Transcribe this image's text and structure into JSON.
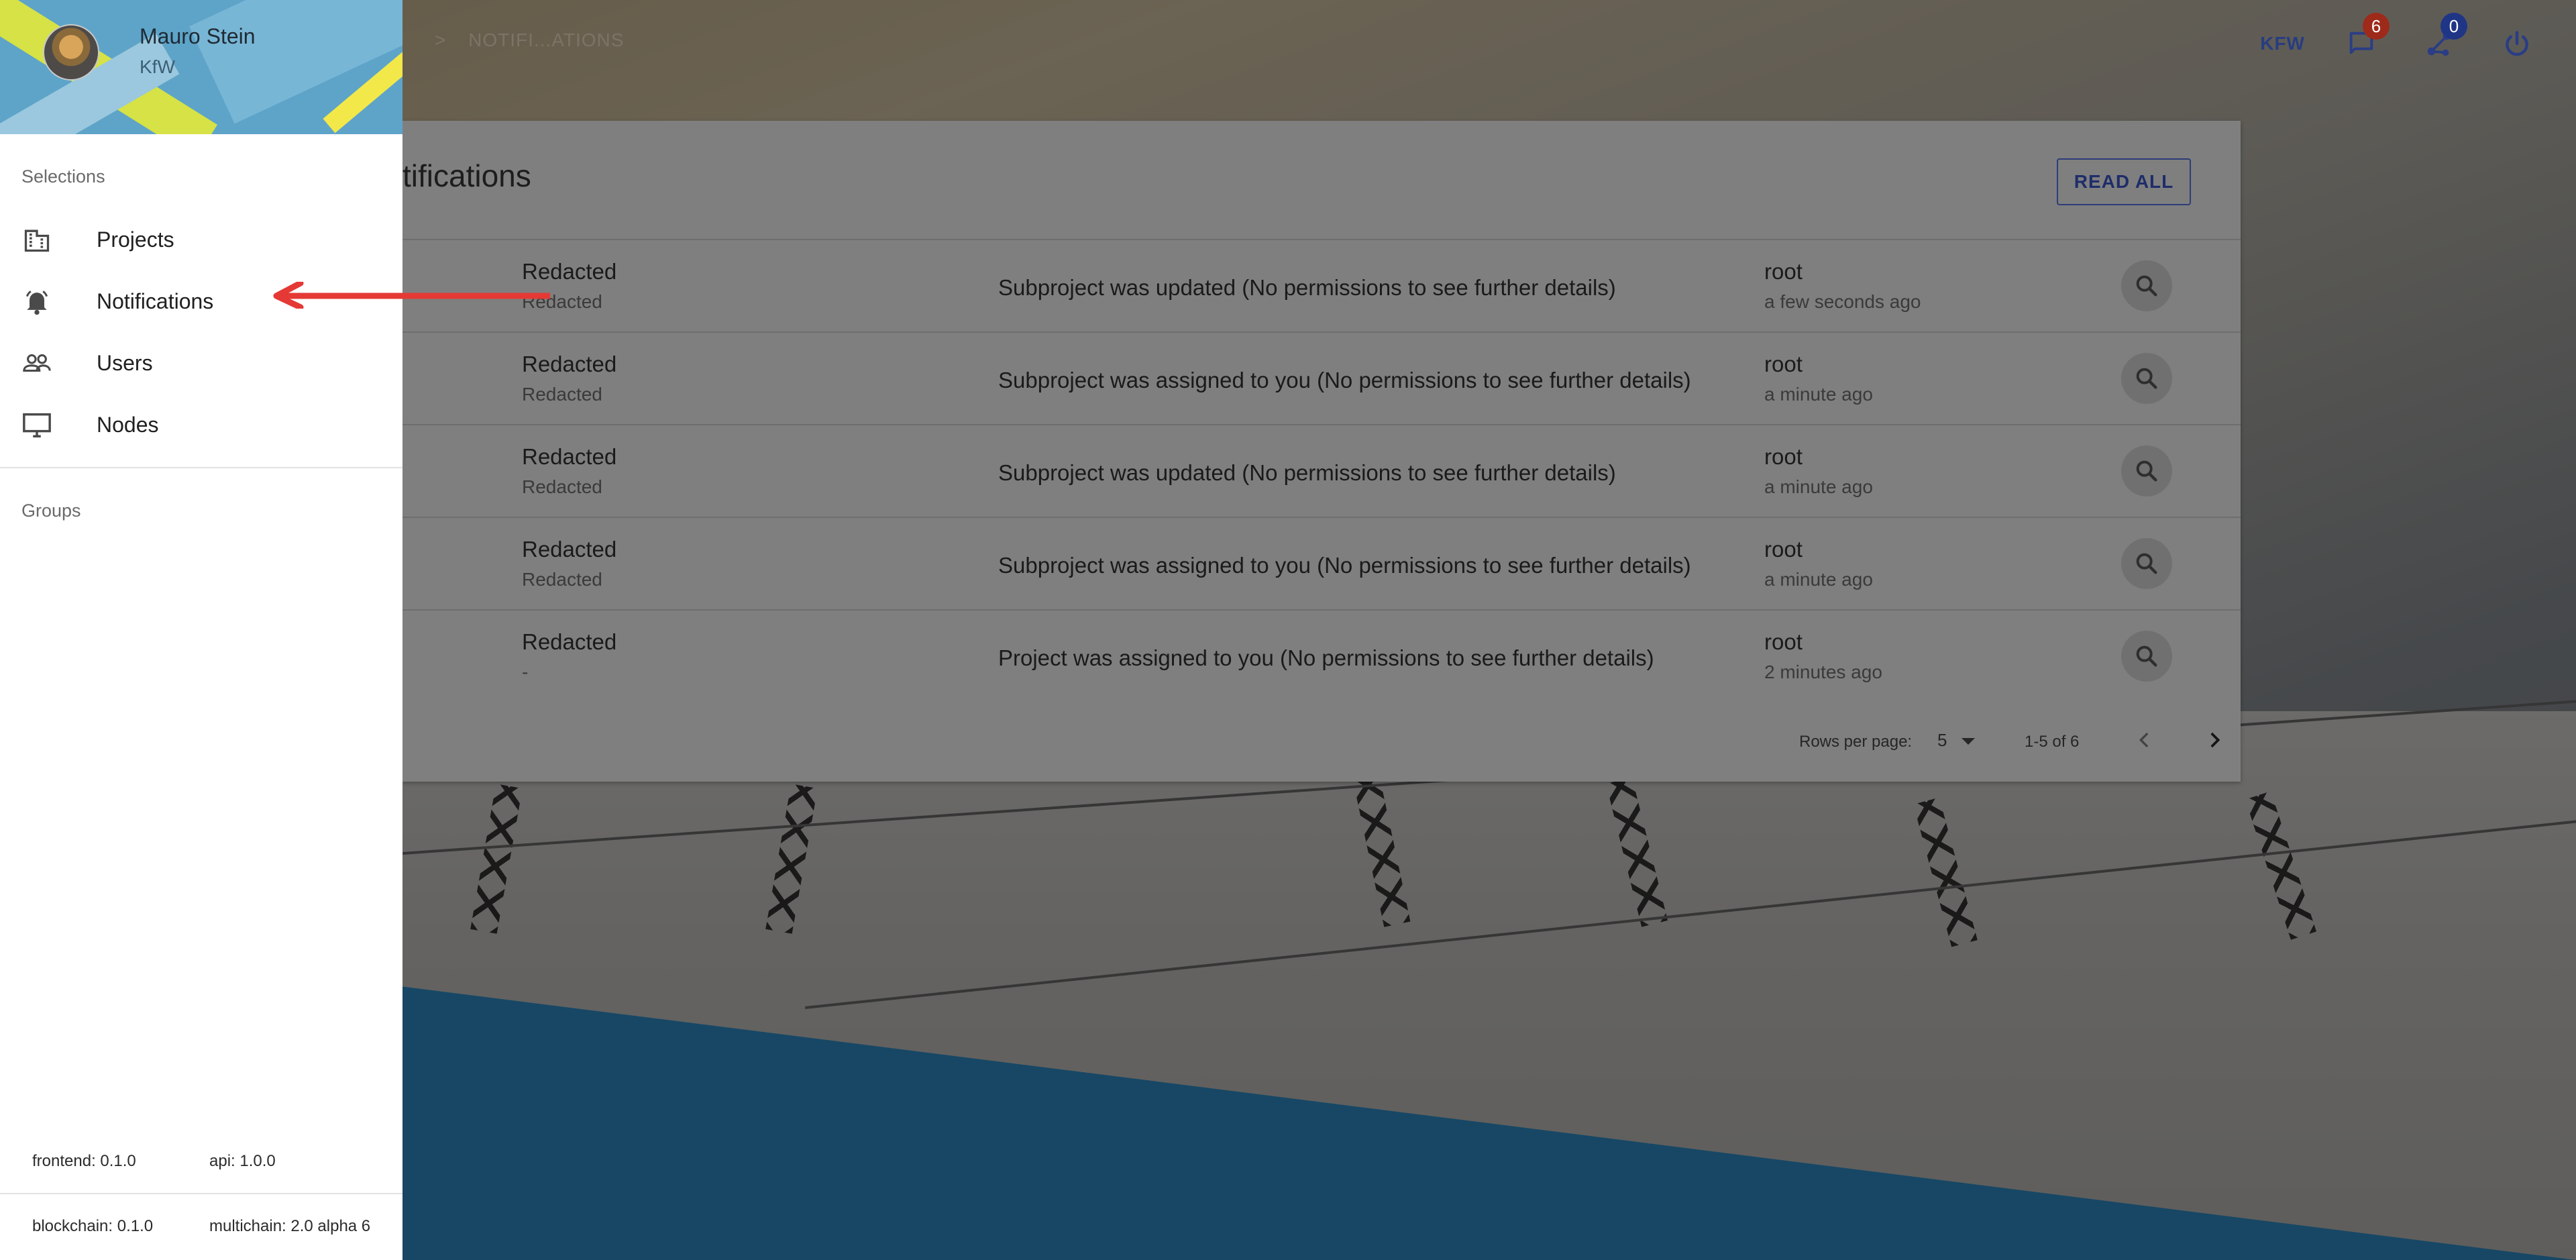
{
  "drawer": {
    "user_name": "Mauro Stein",
    "user_org": "KfW",
    "selections_label": "Selections",
    "items": [
      {
        "label": "Projects",
        "icon": "building-icon"
      },
      {
        "label": "Notifications",
        "icon": "bell-icon"
      },
      {
        "label": "Users",
        "icon": "users-icon"
      },
      {
        "label": "Nodes",
        "icon": "desktop-icon"
      }
    ],
    "groups_label": "Groups",
    "versions": {
      "frontend": "frontend: 0.1.0",
      "api": "api: 1.0.0",
      "blockchain": "blockchain: 0.1.0",
      "multichain": "multichain: 2.0 alpha 6"
    }
  },
  "topbar": {
    "breadcrumb_sep": ">",
    "breadcrumb": "NOTIFI...ATIONS",
    "org": "KFW",
    "notifications_count": "6",
    "peers_count": "0"
  },
  "card": {
    "title": "tifications",
    "read_all_label": "READ ALL",
    "rows": [
      {
        "primary": "Redacted",
        "secondary": "Redacted",
        "message": "Subproject was updated (No permissions to see further details)",
        "user": "root",
        "time": "a few seconds ago"
      },
      {
        "primary": "Redacted",
        "secondary": "Redacted",
        "message": "Subproject was assigned to you (No permissions to see further details)",
        "user": "root",
        "time": "a minute ago"
      },
      {
        "primary": "Redacted",
        "secondary": "Redacted",
        "message": "Subproject was updated (No permissions to see further details)",
        "user": "root",
        "time": "a minute ago"
      },
      {
        "primary": "Redacted",
        "secondary": "Redacted",
        "message": "Subproject was assigned to you (No permissions to see further details)",
        "user": "root",
        "time": "a minute ago"
      },
      {
        "primary": "Redacted",
        "secondary": "-",
        "message": "Project was assigned to you (No permissions to see further details)",
        "user": "root",
        "time": "2 minutes ago"
      }
    ],
    "pager": {
      "rows_per_page_label": "Rows per page:",
      "rows_per_page_value": "5",
      "range": "1-5 of 6"
    }
  },
  "colors": {
    "annotation_arrow": "#e53935",
    "brand_blue": "#283d80",
    "badge_red": "#d32f2f"
  }
}
